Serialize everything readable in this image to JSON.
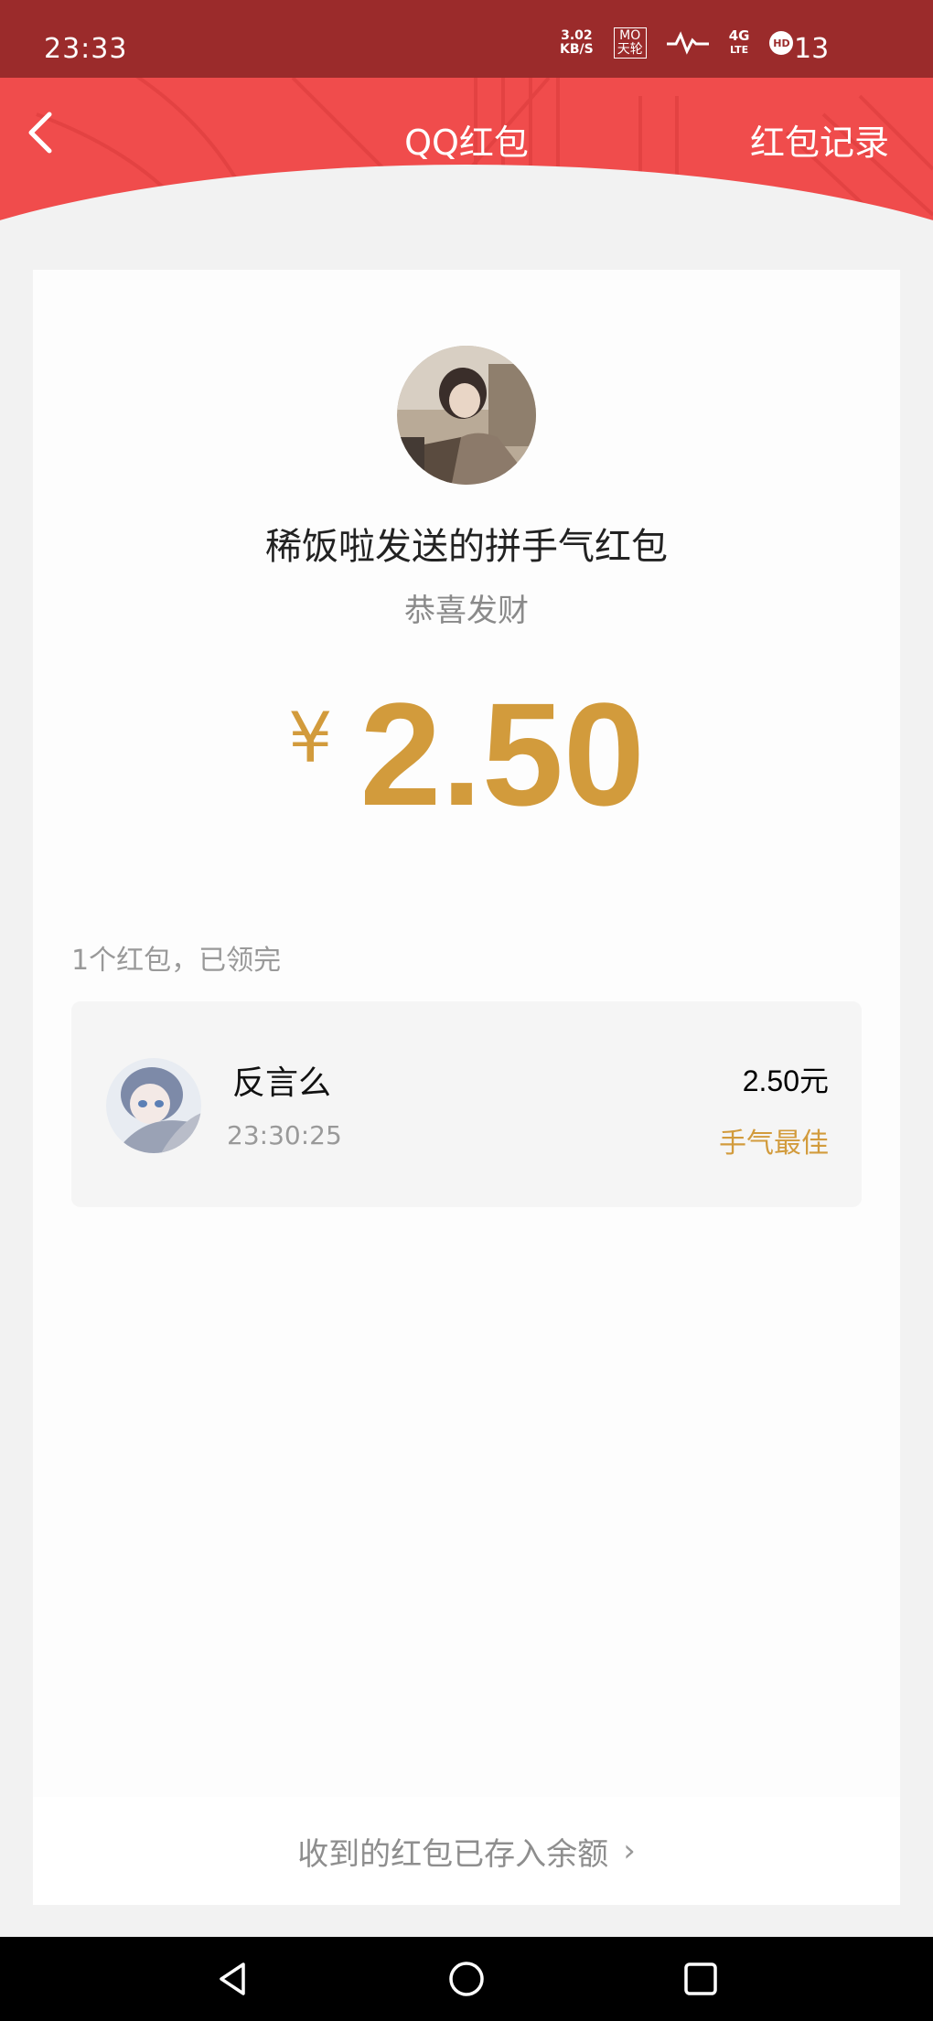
{
  "status_bar": {
    "time": "23:33",
    "net_speed_value": "3.02",
    "net_speed_unit": "KB/S",
    "carrier_top": "MO",
    "carrier_bottom": "天轮",
    "signal_top": "4G",
    "signal_bottom": "LTE",
    "hd_badge": "HD",
    "battery": "13"
  },
  "nav": {
    "title": "QQ红包",
    "records_label": "红包记录"
  },
  "packet": {
    "sender_line": "稀饭啦发送的拼手气红包",
    "greeting": "恭喜发财",
    "currency_symbol": "¥",
    "amount": "2.50"
  },
  "summary": "1个红包，已领完",
  "records": [
    {
      "name": "反言么",
      "time": "23:30:25",
      "amount": "2.50元",
      "badge": "手气最佳"
    }
  ],
  "bottom_link": {
    "label": "收到的红包已存入余额",
    "chevron": "›"
  },
  "colors": {
    "header_red": "#f04c4c",
    "status_bar": "#9b2b2b",
    "amount_gold": "#d29b3c"
  },
  "icons": {
    "back": "chevron-left",
    "nav_back": "triangle-back",
    "nav_home": "circle-home",
    "nav_recent": "square-recent"
  }
}
